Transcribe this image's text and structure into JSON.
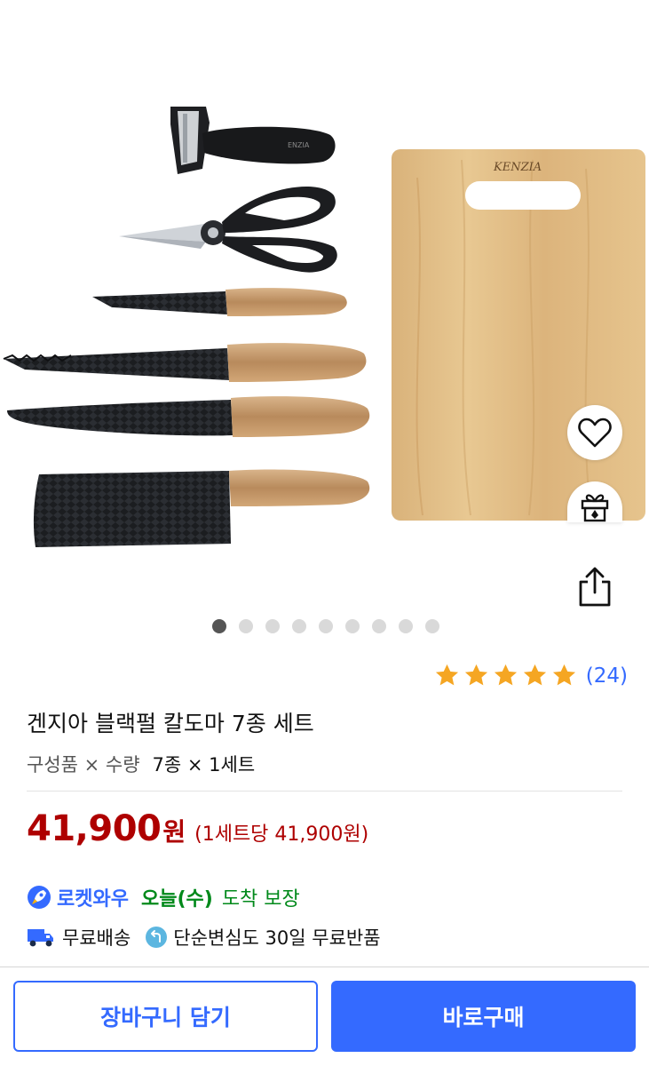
{
  "product": {
    "title": "겐지아 블랙펄 칼도마 7종 세트",
    "option_label": "구성품 × 수량",
    "option_value": "7종 × 1세트",
    "price": "41,900",
    "price_unit": "원",
    "unit_price": "(1세트당 41,900원)",
    "rating_value": 5,
    "rating_count": "(24)"
  },
  "delivery": {
    "rocket_brand": "로켓와우",
    "arrival_day": "오늘(수)",
    "arrival_guarantee": "도착 보장",
    "free_shipping": "무료배송",
    "free_return": "단순변심도 30일 무료반품"
  },
  "gallery": {
    "board_brand": "KENZIA",
    "total_images": 9,
    "active_index": 0
  },
  "actions": {
    "cart_label": "장바구니 담기",
    "buy_label": "바로구매"
  },
  "icons": {
    "heart": "heart-icon",
    "gift": "gift-icon",
    "share": "share-icon",
    "rocket": "rocket-icon",
    "truck": "truck-icon",
    "return": "return-icon"
  },
  "colors": {
    "accent": "#346aff",
    "price": "#ae0000",
    "arrival": "#00891a",
    "star": "#f5a623"
  }
}
